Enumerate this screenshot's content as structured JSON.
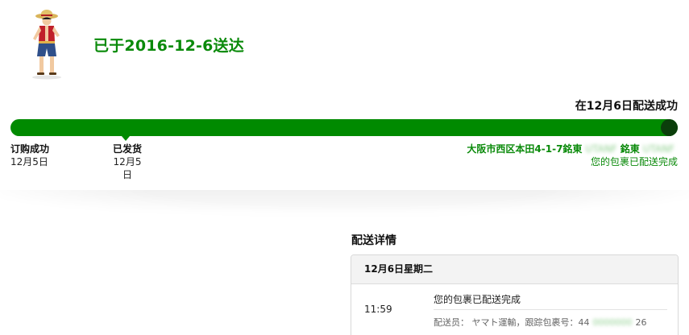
{
  "header": {
    "delivered_title": "已于2016-12-6送达",
    "product_image_icon": "figure-product-icon"
  },
  "status": {
    "arrival_text": "在12月6日配送成功"
  },
  "progress": {
    "fraction": 1.0,
    "accent_color": "#008a00",
    "end_dot_color": "#0b3e0b"
  },
  "milestones": {
    "ordered": {
      "title": "订购成功",
      "date": "12月5日"
    },
    "shipped": {
      "title": "已发货",
      "date": "12月5日"
    },
    "destination": {
      "address_prefix": "大阪市西区本田4-1-7銘東",
      "address_mid": "銘東",
      "status": "您的包裹已配送完成"
    }
  },
  "details": {
    "heading": "配送详情",
    "date_label": "12月6日星期二",
    "event": {
      "time": "11:59",
      "description": "您的包裹已配送完成",
      "carrier_line_prefix": "配送员： ヤマト運輸，跟踪包裹号：44",
      "carrier_line_suffix": "26"
    }
  }
}
